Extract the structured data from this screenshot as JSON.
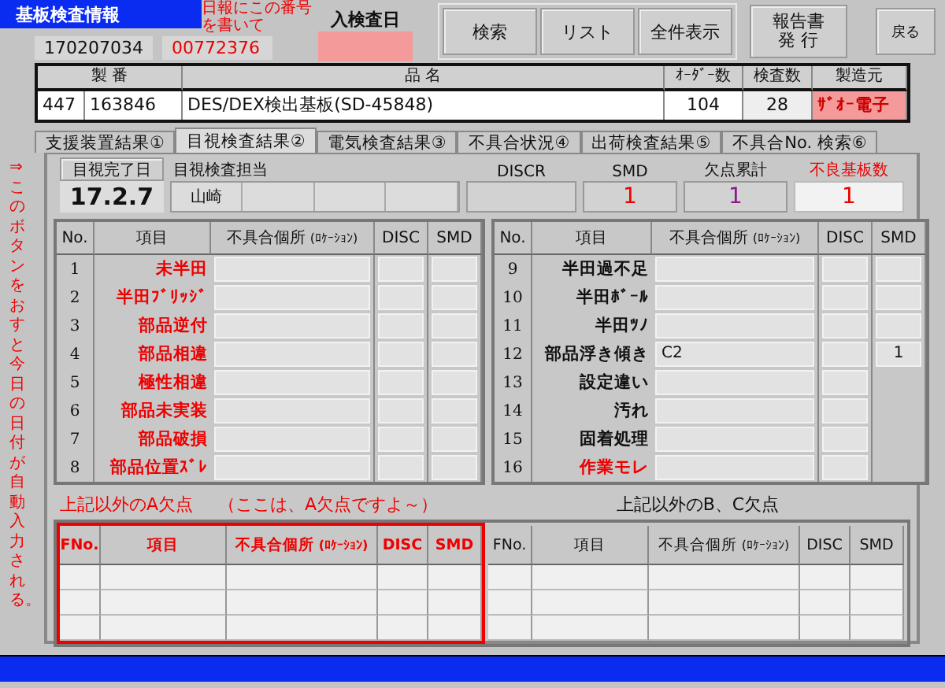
{
  "header": {
    "title": "基板検査情報",
    "note": "日報にこの番号を書いて",
    "serial": "170207034",
    "report_no": "00772376",
    "entry_date_label": "入検査日",
    "buttons": [
      "検索",
      "リスト",
      "全件表示"
    ],
    "report_button": "報告書発 行",
    "back_button": "戻る"
  },
  "product": {
    "columns": [
      "製 番",
      "品 名",
      "ｵｰﾀﾞｰ数",
      "検査数",
      "製造元"
    ],
    "row": {
      "line": "447",
      "serial": "163846",
      "name": "DES/DEX検出基板(SD-45848)",
      "order_qty": "104",
      "inspected_qty": "28",
      "maker": "ｻﾞｵｰ電子"
    }
  },
  "side_note": "⇒このボタンをおすと今日の日付が自動入力される。",
  "tabs": [
    {
      "label": "支援装置結果①",
      "selected": false
    },
    {
      "label": "目視検査結果②",
      "selected": true
    },
    {
      "label": "電気検査結果③",
      "selected": false
    },
    {
      "label": "不具合状況④",
      "selected": false
    },
    {
      "label": "出荷検査結果⑤",
      "selected": false
    },
    {
      "label": "不具合No. 検索⑥",
      "selected": false
    }
  ],
  "panel": {
    "completion_button": "目視完了日",
    "completion_date": "17.2.7",
    "inspector_label": "目視検査担当",
    "inspectors": [
      "山崎"
    ],
    "discr_label": "DISCR",
    "smd": {
      "label": "SMD",
      "value": "1"
    },
    "defect_total": {
      "label": "欠点累計",
      "value": "1"
    },
    "bad_boards": {
      "label": "不良基板数",
      "value": "1"
    }
  },
  "tables": [
    {
      "columns": [
        {
          "label": "No."
        },
        {
          "label": "項目"
        },
        {
          "label": "不具合個所",
          "note": "(ﾛｹｰｼｮﾝ)"
        },
        {
          "label": "DISC"
        },
        {
          "label": "SMD"
        }
      ],
      "rows": [
        {
          "no": "1",
          "item": "未半田",
          "color": "#ee0000",
          "smd_field": true
        },
        {
          "no": "2",
          "item": "半田ﾌﾞﾘｯｼﾞ",
          "color": "#ee0000",
          "smd_field": true
        },
        {
          "no": "3",
          "item": "部品逆付",
          "color": "#ee0000",
          "smd_field": true
        },
        {
          "no": "4",
          "item": "部品相違",
          "color": "#ee0000",
          "smd_field": true
        },
        {
          "no": "5",
          "item": "極性相違",
          "color": "#ee0000",
          "smd_field": true
        },
        {
          "no": "6",
          "item": "部品未実装",
          "color": "#ee0000",
          "smd_field": true
        },
        {
          "no": "7",
          "item": "部品破損",
          "color": "#ee0000",
          "smd_field": true
        },
        {
          "no": "8",
          "item": "部品位置ｽﾞﾚ",
          "color": "#ee0000",
          "smd_field": true
        }
      ]
    },
    {
      "columns": [
        {
          "label": "No."
        },
        {
          "label": "項目"
        },
        {
          "label": "不具合個所",
          "note": "(ﾛｹｰｼｮﾝ)"
        },
        {
          "label": "DISC"
        },
        {
          "label": "SMD"
        }
      ],
      "rows": [
        {
          "no": "9",
          "item": "半田過不足",
          "color": "#111111",
          "smd_field": true
        },
        {
          "no": "10",
          "item": "半田ﾎﾞｰﾙ",
          "color": "#111111",
          "smd_field": true
        },
        {
          "no": "11",
          "item": "半田ﾂﾉ",
          "color": "#111111",
          "smd_field": true
        },
        {
          "no": "12",
          "item": "部品浮き傾き",
          "color": "#111111",
          "location": "C2",
          "smd": "1",
          "smd_field": true
        },
        {
          "no": "13",
          "item": "設定違い",
          "color": "#111111",
          "smd_field": false
        },
        {
          "no": "14",
          "item": "汚れ",
          "color": "#111111",
          "smd_field": false
        },
        {
          "no": "15",
          "item": "固着処理",
          "color": "#111111",
          "smd_field": false
        },
        {
          "no": "16",
          "item": "作業モレ",
          "color": "#ee0000",
          "smd_field": false
        }
      ]
    }
  ],
  "extra": [
    {
      "title": "上記以外のA欠点",
      "hint": "（ここは、A欠点ですよ～）",
      "highlighted": true,
      "columns": [
        {
          "label": "FNo."
        },
        {
          "label": "項目"
        },
        {
          "label": "不具合個所",
          "note": "(ﾛｹｰｼｮﾝ)"
        },
        {
          "label": "DISC"
        },
        {
          "label": "SMD"
        }
      ]
    },
    {
      "title": "上記以外のB、C欠点",
      "highlighted": false,
      "columns": [
        {
          "label": "FNo."
        },
        {
          "label": "項目"
        },
        {
          "label": "不具合個所",
          "note": "(ﾛｹｰｼｮﾝ)"
        },
        {
          "label": "DISC"
        },
        {
          "label": "SMD"
        }
      ]
    }
  ]
}
